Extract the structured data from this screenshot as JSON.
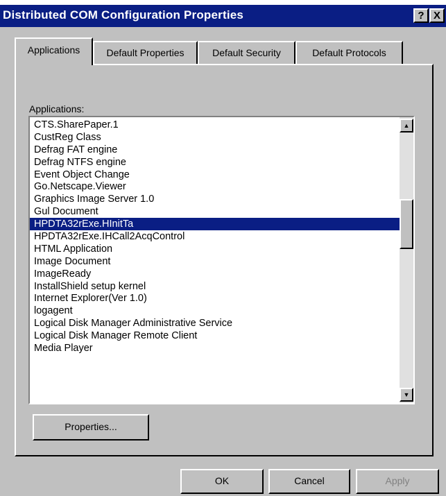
{
  "window": {
    "title": "Distributed COM Configuration Properties",
    "help_label": "?",
    "close_label": "X"
  },
  "tabs": [
    {
      "label": "Applications",
      "active": true
    },
    {
      "label": "Default Properties",
      "active": false
    },
    {
      "label": "Default Security",
      "active": false
    },
    {
      "label": "Default Protocols",
      "active": false
    }
  ],
  "applications": {
    "label": "Applications:",
    "selected": "HPDTA32rExe.HInitTa",
    "items": [
      "CTS.SharePaper.1",
      "CustReg Class",
      "Defrag FAT engine",
      "Defrag NTFS engine",
      "Event Object Change",
      "Go.Netscape.Viewer",
      "Graphics Image Server 1.0",
      "Gul Document",
      "HPDTA32rExe.HInitTa",
      "HPDTA32rExe.IHCall2AcqControl",
      "HTML Application",
      "Image Document",
      "ImageReady",
      "InstallShield setup kernel",
      "Internet Explorer(Ver 1.0)",
      "logagent",
      "Logical Disk Manager Administrative Service",
      "Logical Disk Manager Remote Client",
      "Media Player"
    ]
  },
  "buttons": {
    "properties": "Properties...",
    "ok": "OK",
    "cancel": "Cancel",
    "apply": "Apply",
    "apply_enabled": false
  },
  "colors": {
    "title_bar": "#0a1e84",
    "selection": "#0a1e84",
    "face": "#c0c0c0"
  }
}
